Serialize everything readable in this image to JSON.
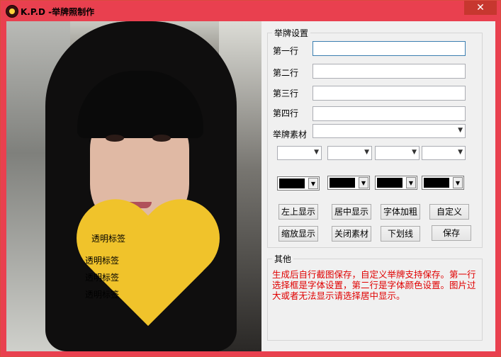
{
  "window": {
    "title": "K.P.D -举牌照制作",
    "close_label": "✕"
  },
  "photo": {
    "tags": [
      "透明标签",
      "透明标签",
      "透明标签",
      "透明标签"
    ]
  },
  "settings": {
    "group_title": "举牌设置",
    "row_labels": [
      "第一行",
      "第二行",
      "第三行",
      "第四行"
    ],
    "row_values": [
      "",
      "",
      "",
      ""
    ],
    "material_label": "举牌素材",
    "material_value": "",
    "font_selects": [
      "",
      "",
      "",
      ""
    ],
    "color_selects": [
      "#000000",
      "#000000",
      "#000000",
      "#000000"
    ],
    "buttons_row1": [
      "左上显示",
      "居中显示",
      "字体加粗",
      "自定义"
    ],
    "buttons_row2": [
      "缩放显示",
      "关闭素材",
      "下划线",
      "保存"
    ]
  },
  "other": {
    "group_title": "其他",
    "text": "生成后自行截图保存，自定义举牌支持保存。第一行选择框是字体设置，第二行是字体颜色设置。图片过大或者无法显示请选择居中显示。"
  },
  "colors": {
    "title_bar": "#e9404f",
    "info_text": "#e00000"
  }
}
